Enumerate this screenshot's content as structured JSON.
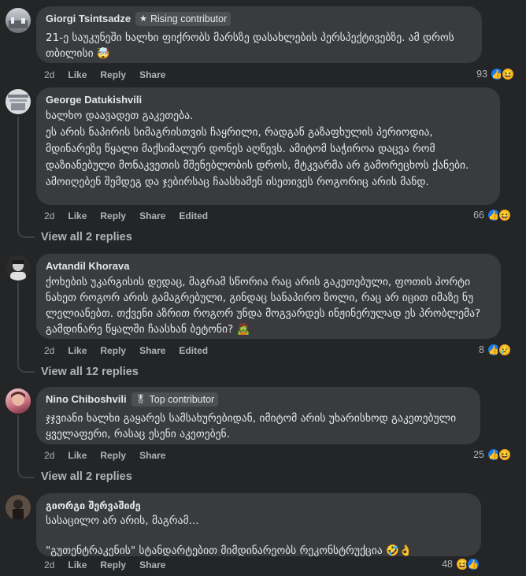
{
  "comments": [
    {
      "author": "Giorgi Tsintsadze",
      "badge": "Rising contributor",
      "text": "21-ე საუკუნეში ხალხი ფიქრობს მარსზე დასახლების პერსპექტივებზე. ამ დროს თბილისი 🤯",
      "time": "2d",
      "like": "Like",
      "reply": "Reply",
      "share": "Share",
      "edited": "",
      "count": "93",
      "reactions": [
        "like-icon",
        "haha-icon"
      ]
    },
    {
      "author": "George Datukishvili",
      "badge": "",
      "text": "ხალხო დაავადეთ გაკეთება.\nეს არის ნაპირის სიმაგრისთვის ჩაყრილი, რადგან გაზაფხულის პერიოდია, მდინარეზე წყალი მაქსიმალურ დონეს აღწევს. ამიტომ საჭიროა დაცვა რომ დაზიანებული მონაკვეთის მშენებლობის დროს, მტკვარმა არ გამორეცხოს ქანები. ამოიღებენ შემდეგ და ჯებირსაც ჩაასხამენ ისეთივეს როგორიც არის მანდ.",
      "time": "2d",
      "like": "Like",
      "reply": "Reply",
      "share": "Share",
      "edited": "Edited",
      "count": "66",
      "reactions": [
        "like-icon",
        "haha-icon"
      ],
      "view_replies": "View all 2 replies"
    },
    {
      "author": "Avtandil Khorava",
      "badge": "",
      "text": "ქოხების უკარგისის დედაც, მაგრამ სწორია რაც არის გაკეთებული, ფოთის პორტი ნახეთ როგორ არის გამაგრებული, გინდაც სანაპირო ზოლი, რაც არ იცით იმაზე ნუ ლელიანებთ. თქვენი აზრით როგორ უნდა მოგვარდეს ინჟინერულად ეს პრობლემა? გამდინარე წყალში ჩაასხან ბეტონი? 🧟",
      "time": "2d",
      "like": "Like",
      "reply": "Reply",
      "share": "Share",
      "edited": "Edited",
      "count": "8",
      "reactions": [
        "like-icon",
        "sad-icon"
      ],
      "view_replies": "View all 12 replies"
    },
    {
      "author": "Nino Chiboshvili",
      "badge": "Top contributor",
      "text": "ჯჯვიანი ხალხი გაყარეს სამსახურებიდან, იმიტომ არის უხარისხოდ გაკეთებული ყველაფერი, რასაც ესენი აკეთებენ.",
      "time": "2d",
      "like": "Like",
      "reply": "Reply",
      "share": "Share",
      "edited": "",
      "count": "25",
      "reactions": [
        "like-icon",
        "haha-icon"
      ],
      "view_replies": "View all 2 replies"
    },
    {
      "author": "გიორგი შერვაშიძე",
      "badge": "",
      "text": "სასაცილო არ არის, მაგრამ...\n\n\"გუთენტრაკენის\" სტანდარტებით მიმდინარეობს რეკონსტრუქცია 🤣👌",
      "time": "2d",
      "like": "Like",
      "reply": "Reply",
      "share": "Share",
      "edited": "",
      "count": "48",
      "reactions": [
        "haha-icon",
        "like-icon"
      ]
    }
  ]
}
